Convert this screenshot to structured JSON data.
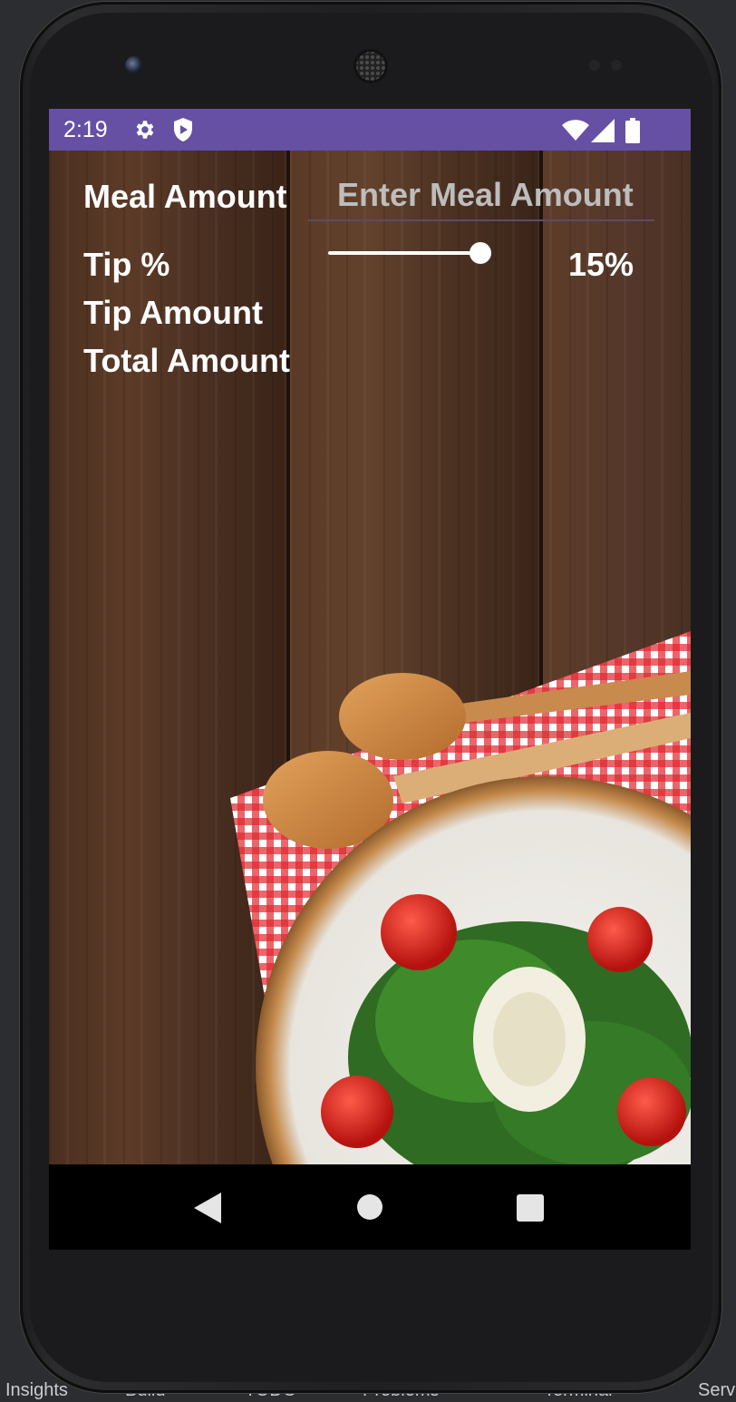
{
  "status_bar": {
    "time": "2:19",
    "icons": [
      "gear-icon",
      "shield-icon",
      "wifi-icon",
      "signal-icon",
      "battery-icon"
    ],
    "color": "#6650a4"
  },
  "form": {
    "meal_amount_label": "Meal Amount",
    "meal_amount_placeholder": "Enter Meal Amount",
    "meal_amount_value": "",
    "tip_percent_label": "Tip %",
    "tip_percent_value": "15%",
    "tip_slider_level": 0.95,
    "tip_amount_label": "Tip Amount",
    "total_amount_label": "Total Amount"
  },
  "nav_bar": {
    "icons": [
      "back-icon",
      "home-icon",
      "recent-apps-icon"
    ]
  },
  "ide": {
    "bottom_tabs": [
      "Insights",
      "Build",
      "TODO",
      "Problems",
      "Terminal",
      "Serv"
    ]
  }
}
